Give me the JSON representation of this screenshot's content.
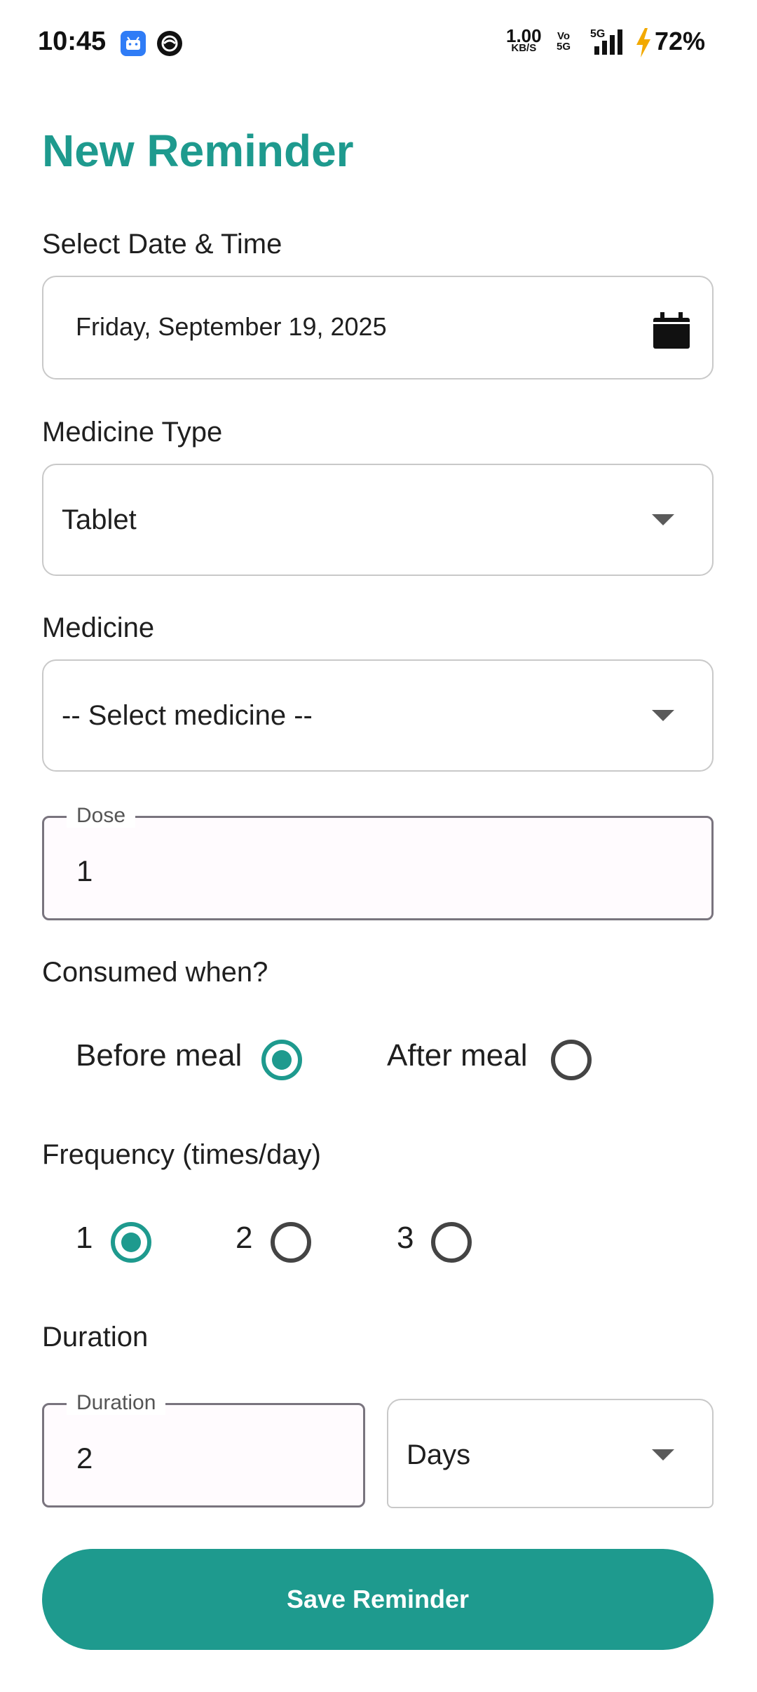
{
  "status_bar": {
    "time": "10:45",
    "net_speed": "1.00",
    "net_unit": "KB/S",
    "volte_top": "Vo",
    "volte_bottom": "5G",
    "network": "5G",
    "battery": "72%"
  },
  "page": {
    "title": "New Reminder"
  },
  "date_section": {
    "label": "Select Date & Time",
    "value": "Friday, September 19, 2025",
    "icon": "calendar-icon"
  },
  "medicine_type": {
    "label": "Medicine Type",
    "value": "Tablet"
  },
  "medicine": {
    "label": "Medicine",
    "value": "-- Select medicine --"
  },
  "dose": {
    "label": "Dose",
    "value": "1"
  },
  "consumed": {
    "label": "Consumed when?",
    "options": [
      {
        "label": "Before meal",
        "selected": true
      },
      {
        "label": "After meal",
        "selected": false
      }
    ]
  },
  "frequency": {
    "label": "Frequency (times/day)",
    "options": [
      {
        "label": "1",
        "selected": true
      },
      {
        "label": "2",
        "selected": false
      },
      {
        "label": "3",
        "selected": false
      }
    ]
  },
  "duration": {
    "label": "Duration",
    "field_label": "Duration",
    "value": "2",
    "unit": "Days"
  },
  "actions": {
    "save_label": "Save Reminder"
  },
  "colors": {
    "accent": "#1e9a8e",
    "charging": "#f2a900"
  }
}
